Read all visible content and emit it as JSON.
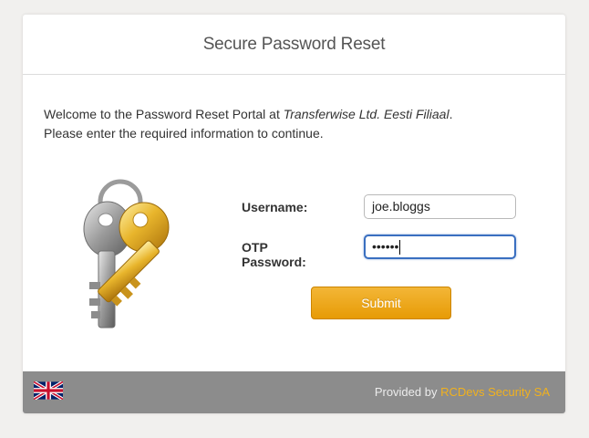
{
  "header": {
    "title": "Secure Password Reset"
  },
  "welcome": {
    "line1_prefix": "Welcome to the Password Reset Portal at ",
    "company": "Transferwise Ltd. Eesti Filiaal",
    "line1_suffix": ".",
    "line2": "Please enter the required information to continue."
  },
  "form": {
    "username_label": "Username:",
    "username_value": "joe.bloggs",
    "otp_label": "OTP Password:",
    "otp_value": "••••••",
    "submit_label": "Submit"
  },
  "footer": {
    "language_icon": "uk-flag-icon",
    "provided_prefix": "Provided by ",
    "provider": "RCDevs Security SA",
    "brand_color": "#f0b11f"
  },
  "colors": {
    "accent": "#e79b06",
    "focus": "#3a6fc0",
    "footer_bg": "#8c8c8c"
  }
}
